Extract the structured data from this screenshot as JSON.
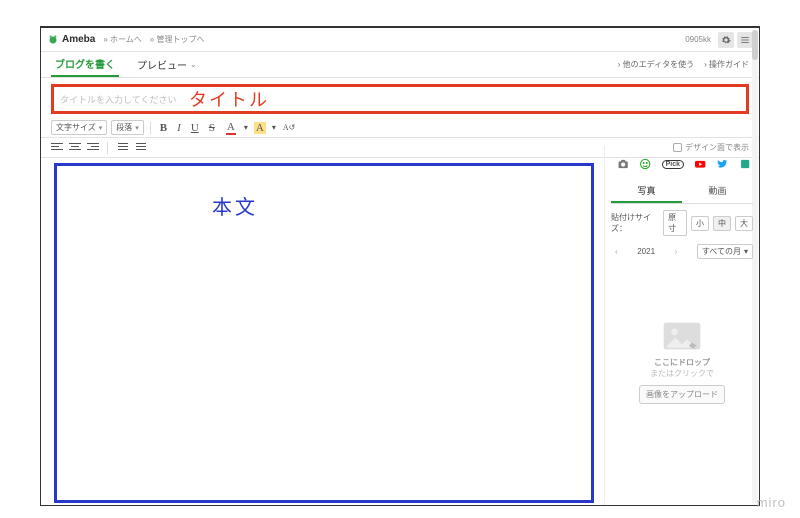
{
  "header": {
    "brand": "Ameba",
    "crumb1": "» ホームへ",
    "crumb2": "» 管理トップへ",
    "user": "0905kk"
  },
  "tabs": {
    "write": "ブログを書く",
    "preview": "プレビュー",
    "link_other_editor": "他のエディタを使う",
    "link_guide": "操作ガイド"
  },
  "title": {
    "placeholder": "タイトルを入力してください",
    "callout": "タイトル"
  },
  "toolbar": {
    "font_size_label": "文字サイズ",
    "paragraph_label": "段落",
    "bold": "B",
    "italic": "I",
    "underline": "U",
    "strike": "S",
    "font_color": "A",
    "bg_color": "A",
    "clear_fmt": "A↺",
    "design_view": "デザイン面で表示"
  },
  "body": {
    "callout": "本文"
  },
  "right": {
    "tab_photo": "写真",
    "tab_video": "動画",
    "size_label": "貼付けサイズ：",
    "size_orig": "原寸",
    "size_s": "小",
    "size_m": "中",
    "size_l": "大",
    "year": "2021",
    "month_dd": "すべての月",
    "drop_l1": "ここにドロップ",
    "drop_l2": "またはクリックで",
    "upload_btn": "画像をアップロード"
  },
  "watermark": "miro"
}
